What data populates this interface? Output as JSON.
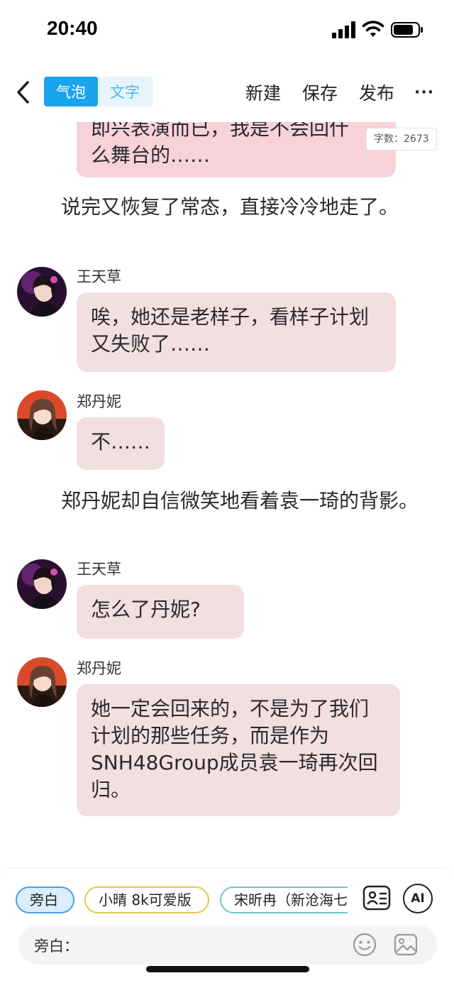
{
  "status": {
    "time": "20:40"
  },
  "toolbar": {
    "tab_bubble": "气泡",
    "tab_text": "文字",
    "new_label": "新建",
    "save_label": "保存",
    "publish_label": "发布",
    "more_label": "···"
  },
  "chat": {
    "word_count": "字数：2673",
    "partial_bubble_line1": "即兴表演而已，我是不会回什",
    "partial_bubble_line2": "么舞台的……",
    "narration_1": "说完又恢复了常态，直接冷冷地走了。",
    "msg_1_speaker": "王天草",
    "msg_1_text": "唉，她还是老样子，看样子计划又失败了……",
    "msg_2_speaker": "郑丹妮",
    "msg_2_text": "不……",
    "narration_2": "郑丹妮却自信微笑地看着袁一琦的背影。",
    "msg_3_speaker": "王天草",
    "msg_3_text": "怎么了丹妮?",
    "msg_4_speaker": "郑丹妮",
    "msg_4_text": "她一定会回来的，不是为了我们计划的那些任务，而是作为SNH48Group成员袁一琦再次回归。"
  },
  "bottom": {
    "chip_narrator": "旁白",
    "chip_2": "小晴 8k可爱版",
    "chip_3": "宋昕冉（新沧海七",
    "ai_label": "AI",
    "input_label": "旁白："
  }
}
